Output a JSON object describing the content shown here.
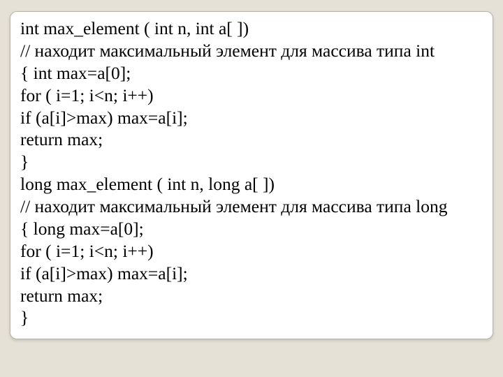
{
  "code": {
    "lines": [
      "int max_element ( int n, int a[ ])",
      "// находит максимальный элемент для массива типа int",
      "{ int max=a[0];",
      "for ( i=1; i<n; i++)",
      "if (a[i]>max) max=a[i];",
      "return max;",
      "}",
      "long max_element ( int n, long a[ ])",
      "// находит максимальный элемент для массива типа long",
      "{ long max=a[0];",
      "for ( i=1; i<n; i++)",
      "if (a[i]>max) max=a[i];",
      "return max;",
      "}"
    ]
  }
}
